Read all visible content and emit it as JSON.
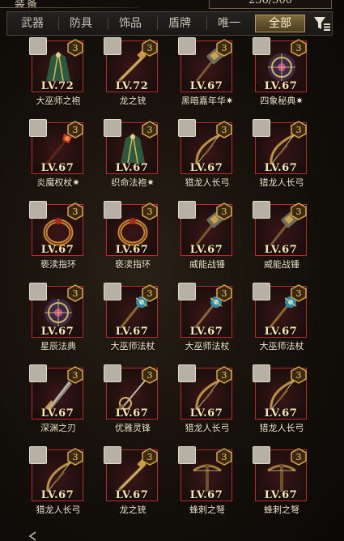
{
  "header": {
    "title": "装备",
    "count": "236/500"
  },
  "tabs": [
    {
      "label": "武器"
    },
    {
      "label": "防具"
    },
    {
      "label": "饰品"
    },
    {
      "label": "盾牌"
    },
    {
      "label": "唯一"
    },
    {
      "label": "全部",
      "active": true
    }
  ],
  "colors": {
    "rarity_border": "#c0272b",
    "badge_gold": "#d9a640",
    "active_tab": "#7d6b3b"
  },
  "items": [
    {
      "name": "大巫师之袍",
      "level": "LV.72",
      "badge": "3",
      "icon": "robe-icon"
    },
    {
      "name": "龙之铳",
      "level": "LV.72",
      "badge": "3",
      "icon": "gun-icon"
    },
    {
      "name": "黑暗嘉年华",
      "level": "LV.67",
      "badge": "3",
      "icon": "hammer-icon",
      "mark": "✷"
    },
    {
      "name": "四象秘典",
      "level": "LV.67",
      "badge": "3",
      "icon": "tome-icon",
      "mark": "✷"
    },
    {
      "name": "炎魔权杖",
      "level": "LV.67",
      "badge": "3",
      "icon": "scepter-icon",
      "mark": "✷"
    },
    {
      "name": "织命法袍",
      "level": "LV.67",
      "badge": "3",
      "icon": "robe-icon",
      "mark": "✷"
    },
    {
      "name": "猎龙人长弓",
      "level": "LV.67",
      "badge": "3",
      "icon": "bow-icon"
    },
    {
      "name": "猎龙人长弓",
      "level": "LV.67",
      "badge": "3",
      "icon": "bow-icon"
    },
    {
      "name": "亵渎指环",
      "level": "LV.67",
      "badge": "3",
      "icon": "ring-icon"
    },
    {
      "name": "亵渎指环",
      "level": "LV.67",
      "badge": "3",
      "icon": "ring-icon"
    },
    {
      "name": "威能战锤",
      "level": "LV.67",
      "badge": "3",
      "icon": "hammer-icon"
    },
    {
      "name": "威能战锤",
      "level": "LV.67",
      "badge": "3",
      "icon": "hammer-icon"
    },
    {
      "name": "星辰法典",
      "level": "LV.67",
      "badge": "3",
      "icon": "tome-icon"
    },
    {
      "name": "大巫师法杖",
      "level": "LV.67",
      "badge": "3",
      "icon": "staff-icon"
    },
    {
      "name": "大巫师法杖",
      "level": "LV.67",
      "badge": "3",
      "icon": "staff-icon"
    },
    {
      "name": "大巫师法杖",
      "level": "LV.67",
      "badge": "3",
      "icon": "staff-icon"
    },
    {
      "name": "深渊之刃",
      "level": "LV.67",
      "badge": "3",
      "icon": "blade-icon"
    },
    {
      "name": "优雅灵锋",
      "level": "LV.67",
      "badge": "3",
      "icon": "rapier-icon"
    },
    {
      "name": "猎龙人长弓",
      "level": "LV.67",
      "badge": "3",
      "icon": "bow-icon"
    },
    {
      "name": "猎龙人长弓",
      "level": "LV.67",
      "badge": "3",
      "icon": "bow-icon"
    },
    {
      "name": "猎龙人长弓",
      "level": "LV.67",
      "badge": "3",
      "icon": "bow-icon"
    },
    {
      "name": "龙之铳",
      "level": "LV.67",
      "badge": "3",
      "icon": "gun-icon"
    },
    {
      "name": "蜂刺之弩",
      "level": "LV.67",
      "badge": "3",
      "icon": "crossbow-icon"
    },
    {
      "name": "蜂刺之弩",
      "level": "LV.67",
      "badge": "3",
      "icon": "crossbow-icon"
    }
  ]
}
